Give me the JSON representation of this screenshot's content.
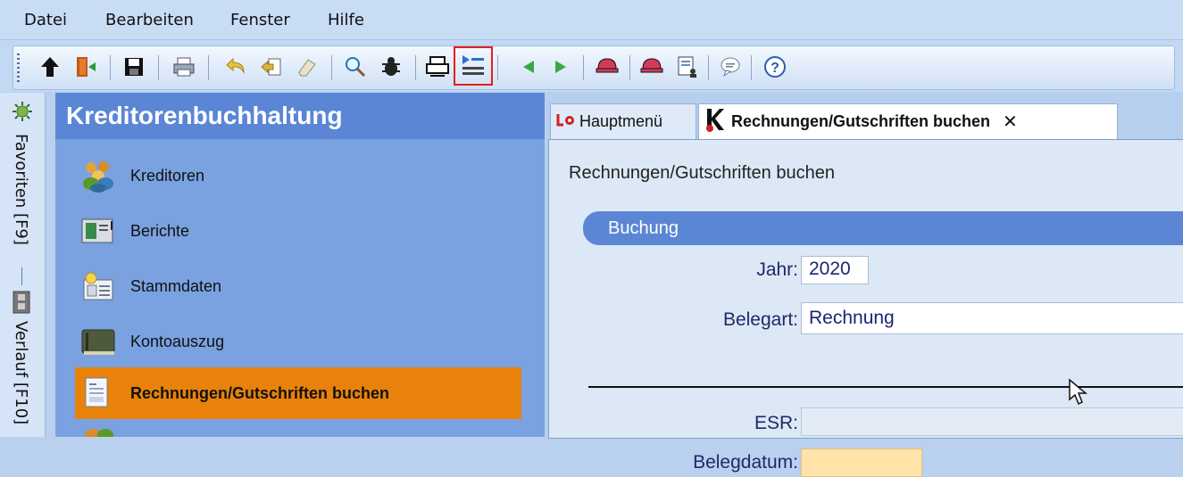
{
  "menu": {
    "items": [
      "Datei",
      "Bearbeiten",
      "Fenster",
      "Hilfe"
    ]
  },
  "toolbar": {
    "buttons": [
      {
        "icon": "arrow-up-icon"
      },
      {
        "icon": "exit-door-icon"
      },
      {
        "icon": "save-disk-icon"
      },
      {
        "icon": "print-icon"
      },
      {
        "icon": "undo-arrow-icon"
      },
      {
        "icon": "import-icon"
      },
      {
        "icon": "eraser-icon"
      },
      {
        "icon": "search-icon"
      },
      {
        "icon": "bug-icon"
      },
      {
        "icon": "printer-icon"
      },
      {
        "icon": "list-play-icon",
        "active": true
      },
      {
        "icon": "arrow-left-icon"
      },
      {
        "icon": "arrow-right-icon"
      },
      {
        "icon": "hat-icon"
      },
      {
        "icon": "hat-icon"
      },
      {
        "icon": "document-person-icon"
      },
      {
        "icon": "speech-bubble-icon"
      },
      {
        "icon": "help-icon"
      }
    ],
    "active_highlight_color": "#e21f1f"
  },
  "sidebar": {
    "tabs": [
      {
        "label": "Favoriten [F9]",
        "icon": "gear-star-icon"
      },
      {
        "label": "Verlauf [F10]",
        "icon": "film-strip-icon"
      }
    ]
  },
  "nav": {
    "title": "Kreditorenbuchhaltung",
    "items": [
      {
        "label": "Kreditoren",
        "icon": "people-icon"
      },
      {
        "label": "Berichte",
        "icon": "report-icon"
      },
      {
        "label": "Stammdaten",
        "icon": "master-data-icon"
      },
      {
        "label": "Kontoauszug",
        "icon": "ledger-book-icon"
      },
      {
        "label": "Rechnungen/Gutschriften buchen",
        "icon": "invoice-icon",
        "selected": true
      }
    ],
    "selected_color": "#e8820a"
  },
  "tabs": {
    "home": "Hauptmenü",
    "active": "Rechnungen/Gutschriften buchen",
    "close_symbol": "✕"
  },
  "form": {
    "heading": "Rechnungen/Gutschriften buchen",
    "section": "Buchung",
    "fields": {
      "jahr": {
        "label": "Jahr:",
        "value": "2020"
      },
      "belegart": {
        "label": "Belegart:",
        "value": "Rechnung"
      },
      "esr": {
        "label": "ESR:",
        "value": ""
      },
      "belegdatum": {
        "label": "Belegdatum:",
        "value": ""
      }
    }
  }
}
